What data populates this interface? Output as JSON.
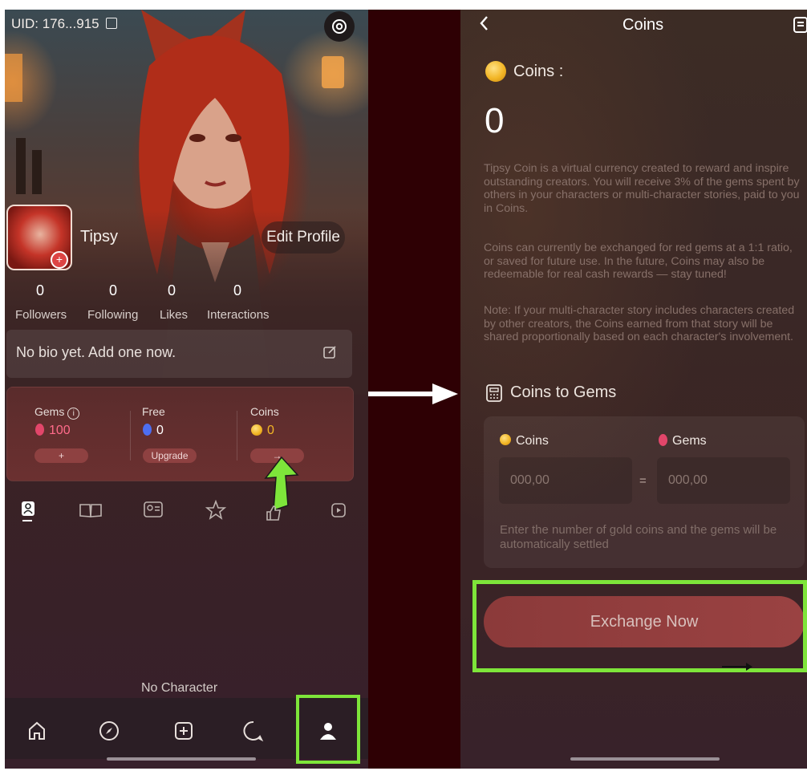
{
  "left": {
    "uid": "UID: 176...915",
    "username": "Tipsy",
    "edit_profile": "Edit Profile",
    "stats": [
      {
        "value": "0",
        "label": "Followers"
      },
      {
        "value": "0",
        "label": "Following"
      },
      {
        "value": "0",
        "label": "Likes"
      },
      {
        "value": "0",
        "label": "Interactions"
      }
    ],
    "bio": "No bio yet. Add one now.",
    "wallet": {
      "gems_label": "Gems",
      "gems_value": "100",
      "gems_button": "+",
      "free_label": "Free",
      "free_value": "0",
      "free_button": "Upgrade",
      "coins_label": "Coins",
      "coins_value": "0",
      "coins_button": "→"
    },
    "empty_state": "No Character",
    "accent_color": "#7ee53a"
  },
  "right": {
    "title": "Coins",
    "coins_label": "Coins :",
    "coins_value": "0",
    "paragraph_1": "Tipsy Coin is a virtual currency created to reward and inspire outstanding creators. You will receive 3% of the gems spent by others in your characters or multi-character stories, paid to you in Coins.",
    "paragraph_2": "Coins can currently be exchanged for red gems at a 1:1 ratio, or saved for future use. In the future, Coins may also be redeemable for real cash rewards — stay tuned!",
    "paragraph_3": "Note: If your multi-character story includes characters created by other creators, the Coins earned from that story will be shared proportionally based on each character's involvement.",
    "coins_to_gems": "Coins to Gems",
    "coins_col": "Coins",
    "gems_col": "Gems",
    "coins_placeholder": "000,00",
    "gems_placeholder": "000,00",
    "equals": "=",
    "help": "Enter the number of gold coins and the gems will be automatically settled",
    "exchange_button": "Exchange Now"
  }
}
